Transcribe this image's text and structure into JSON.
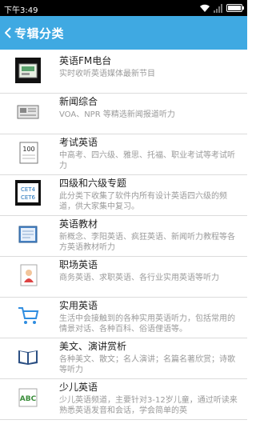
{
  "status": {
    "time": "下午3:49"
  },
  "appbar": {
    "title": "专辑分类"
  },
  "items": [
    {
      "title": "英语FM电台",
      "desc": "实时收听英语媒体最新节目",
      "icon": "radio-icon"
    },
    {
      "title": "新闻综合",
      "desc": "VOA、NPR 等精选新闻报道听力",
      "icon": "newspaper-icon"
    },
    {
      "title": "考试英语",
      "desc": "中高考、四六级、雅思、托福、职业考试等考试听力",
      "icon": "exam-paper-icon",
      "badge": "100"
    },
    {
      "title": "四级和六级专题",
      "desc": "此分类下收集了软件内所有设计英语四六级的频道，供大家集中复习。",
      "icon": "cet-icon",
      "badge1": "CET4",
      "badge2": "CET6"
    },
    {
      "title": "英语教材",
      "desc": "新概念、李阳英语、疯狂英语、新闻听力教程等各方英语教材听力",
      "icon": "textbook-icon"
    },
    {
      "title": "职场英语",
      "desc": "商务英语、求职英语、各行业实用英语等听力",
      "icon": "business-person-icon"
    },
    {
      "title": "实用英语",
      "desc": "生活中会接触到的各种实用英语听力，包括常用的情景对话、各种百科、俗语俚语等。",
      "icon": "shopping-cart-icon"
    },
    {
      "title": "美文、演讲赏析",
      "desc": "各种美文、散文；名人演讲；名篇名著欣赏；诗歌等听力",
      "icon": "open-book-icon"
    },
    {
      "title": "少儿英语",
      "desc": "少儿英语频道，主要针对3-12岁儿童，通过听读来熟悉英语发音和会话，学会简单的英",
      "icon": "abc-blocks-icon",
      "badge": "ABC"
    }
  ]
}
